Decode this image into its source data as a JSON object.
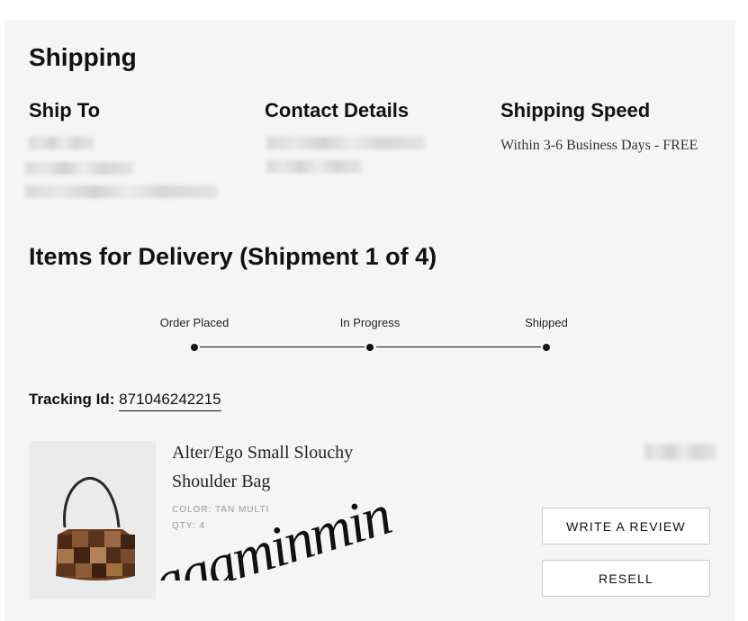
{
  "shipping": {
    "title": "Shipping",
    "ship_to_title": "Ship To",
    "contact_title": "Contact Details",
    "speed_title": "Shipping Speed",
    "speed_value": "Within 3-6 Business Days - FREE"
  },
  "delivery": {
    "title": "Items for Delivery (Shipment 1 of 4)",
    "steps": [
      {
        "label": "Order Placed"
      },
      {
        "label": "In Progress"
      },
      {
        "label": "Shipped"
      }
    ],
    "tracking_label": "Tracking Id:",
    "tracking_id": "871046242215"
  },
  "item": {
    "name": "Alter/Ego Small Slouchy Shoulder Bag",
    "color": "COLOR: TAN MULTI",
    "qty": "QTY: 4",
    "review_button": "WRITE A REVIEW",
    "resell_button": "RESELL"
  },
  "overlay": {
    "signature_text": "aaaminmin"
  }
}
